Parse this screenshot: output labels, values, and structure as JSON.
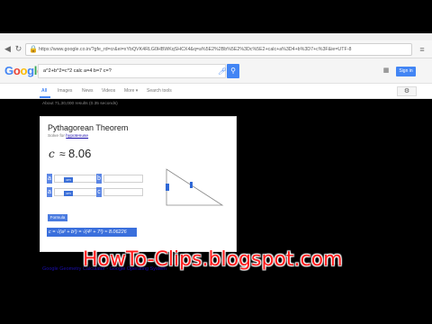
{
  "browser": {
    "url": "https://www.google.co.in/?gfe_rd=cr&ei=...#q=a%5E2%2Bb%5E2%3Dc%5E2+calc+a%3D4+b%3D7+c%3F",
    "url_visible": "https://www.google.co.in/?gfe_rd=cr&ei=xYbQVK4RLG0HBWKqSHCX4&q=a%5E2%2Bb%5E2%3Dc%5E2+calc+a%3D4+b%3D7+c%3F&ie=UTF-8"
  },
  "header": {
    "logo": "Google",
    "logo_colors": [
      "#4285f4",
      "#ea4335",
      "#fbbc05",
      "#4285f4",
      "#34a853",
      "#ea4335"
    ],
    "query": "a^2+b^2=c^2 calc a=4 b=7 c=?",
    "signin_label": "Sign in"
  },
  "tabs": {
    "items": [
      "All",
      "Images",
      "News",
      "Videos",
      "More ▾",
      "Search tools"
    ]
  },
  "stats": "About 71,30,000 results (0.35 seconds)",
  "calculator": {
    "title": "Pythagorean Theorem",
    "solve_for_prefix": "Solve for ",
    "solve_for_link": "hypotenuse",
    "result_var": "c",
    "approx": "≈",
    "result_value": "8.06",
    "fields": [
      {
        "label": "a",
        "unit": "cm"
      },
      {
        "label": "b",
        "unit": "cm"
      },
      {
        "label": "c",
        "unit": ""
      },
      {
        "label": "c",
        "unit": ""
      }
    ],
    "formula_label": "Formula",
    "formula": "c = √(a² + b²) = √(4² + 7²) ≈ 8.06226"
  },
  "next_result": "Google Geometry Calculator - Google Operating System",
  "watermark": "HowTo-Clips.blogspot.com",
  "colors": {
    "accent": "#4285f4",
    "watermark": "#ff1a1a"
  }
}
